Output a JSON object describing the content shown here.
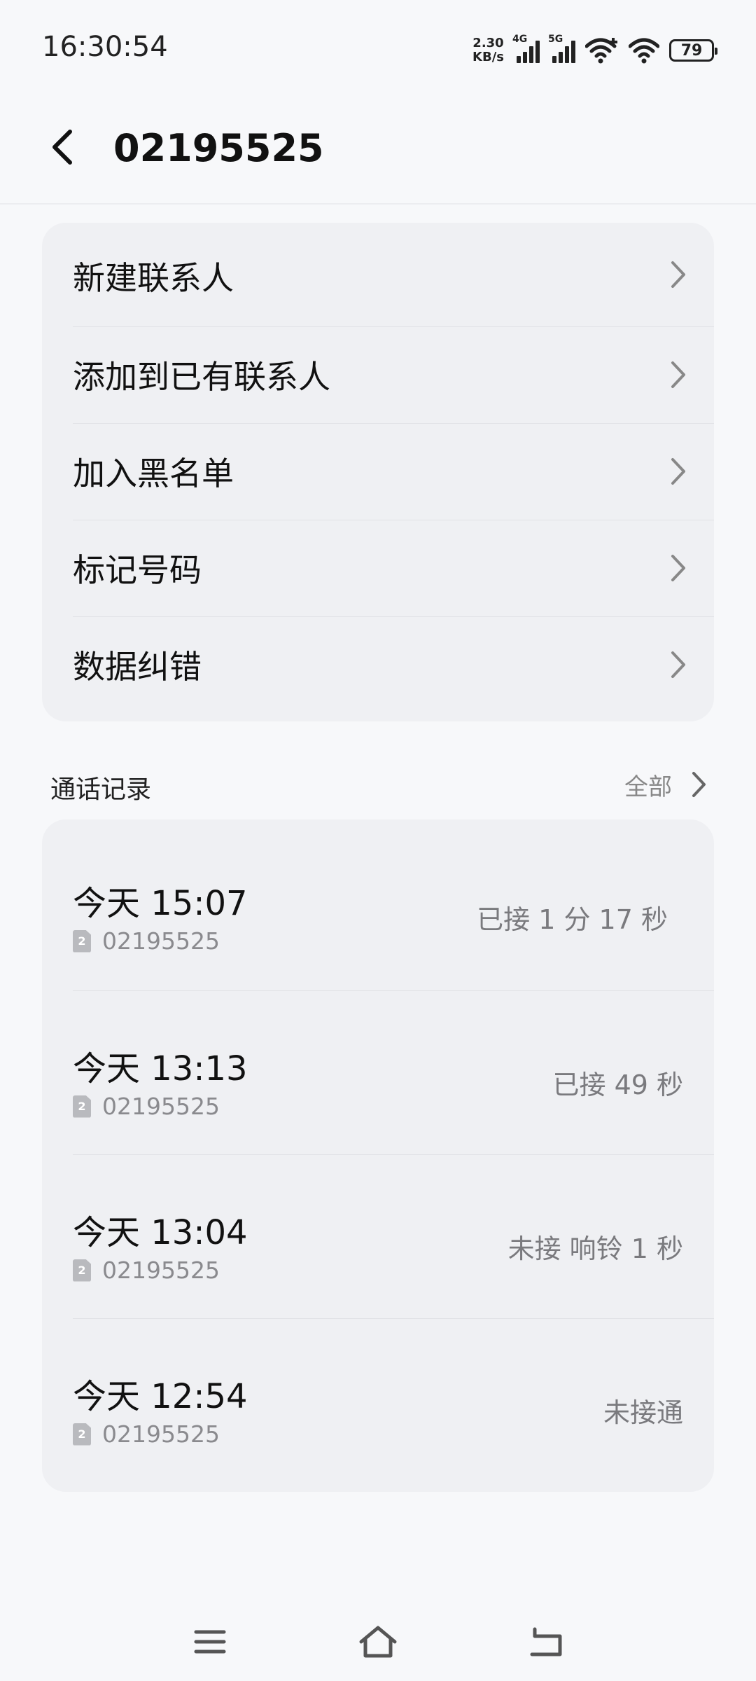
{
  "status_bar": {
    "time": "16:30:54",
    "net_speed_value": "2.30",
    "net_speed_unit": "KB/s",
    "sim1_network": "4G",
    "sim2_network": "5G",
    "battery": "79"
  },
  "header": {
    "title": "02195525"
  },
  "menu": {
    "items": [
      {
        "label": "新建联系人"
      },
      {
        "label": "添加到已有联系人"
      },
      {
        "label": "加入黑名单"
      },
      {
        "label": "标记号码"
      },
      {
        "label": "数据纠错"
      }
    ]
  },
  "call_log": {
    "title": "通话记录",
    "all_label": "全部",
    "sim_badge": "2",
    "entries": [
      {
        "time": "今天 15:07",
        "number": "02195525",
        "status": "已接 1 分 17 秒"
      },
      {
        "time": "今天 13:13",
        "number": "02195525",
        "status": "已接 49 秒"
      },
      {
        "time": "今天 13:04",
        "number": "02195525",
        "status": "未接  响铃 1 秒"
      },
      {
        "time": "今天 12:54",
        "number": "02195525",
        "status": "未接通"
      }
    ]
  },
  "colors": {
    "background": "#F7F8FA",
    "card": "#EFF0F3",
    "text_primary": "#111111",
    "text_secondary": "#8A8A8E"
  },
  "icons": {
    "back": "back-arrow-icon",
    "chevron": "chevron-right-icon",
    "sim": "sim-card-icon",
    "nav_menu": "menu-icon",
    "nav_home": "home-icon",
    "nav_back": "back-icon"
  }
}
